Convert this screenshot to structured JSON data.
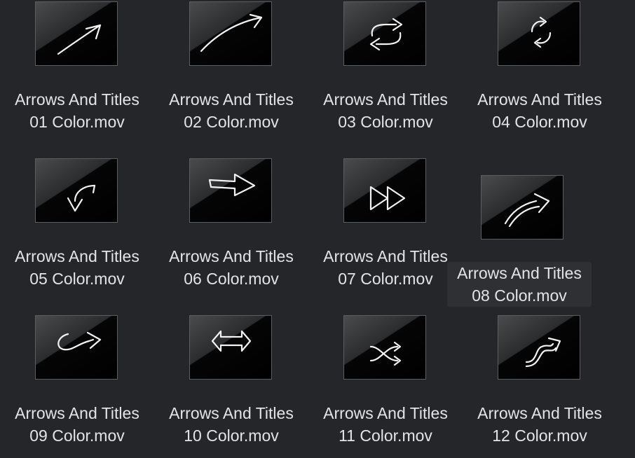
{
  "files": [
    {
      "name_line1": "Arrows And Titles",
      "name_line2": "01 Color.mov",
      "icon": "straight-arrow-icon"
    },
    {
      "name_line1": "Arrows And Titles",
      "name_line2": "02 Color.mov",
      "icon": "curved-arrow-icon"
    },
    {
      "name_line1": "Arrows And Titles",
      "name_line2": "03 Color.mov",
      "icon": "repeat-arrows-icon"
    },
    {
      "name_line1": "Arrows And Titles",
      "name_line2": "04 Color.mov",
      "icon": "circular-refresh-icon"
    },
    {
      "name_line1": "Arrows And Titles",
      "name_line2": "05 Color.mov",
      "icon": "curved-down-arrow-icon"
    },
    {
      "name_line1": "Arrows And Titles",
      "name_line2": "06 Color.mov",
      "icon": "right-arrow-icon"
    },
    {
      "name_line1": "Arrows And Titles",
      "name_line2": "07 Color.mov",
      "icon": "fast-forward-icon"
    },
    {
      "name_line1": "Arrows And Titles",
      "name_line2": "08 Color.mov",
      "icon": "curved-up-arrow-icon"
    },
    {
      "name_line1": "Arrows And Titles",
      "name_line2": "09 Color.mov",
      "icon": "loop-arrow-icon"
    },
    {
      "name_line1": "Arrows And Titles",
      "name_line2": "10 Color.mov",
      "icon": "double-arrow-icon"
    },
    {
      "name_line1": "Arrows And Titles",
      "name_line2": "11 Color.mov",
      "icon": "shuffle-arrows-icon"
    },
    {
      "name_line1": "Arrows And Titles",
      "name_line2": "12 Color.mov",
      "icon": "s-curve-arrow-icon"
    }
  ],
  "colors": {
    "background": "#25262a",
    "label_text": "#e4e4e6",
    "icon_stroke": "#f2f2f2"
  }
}
